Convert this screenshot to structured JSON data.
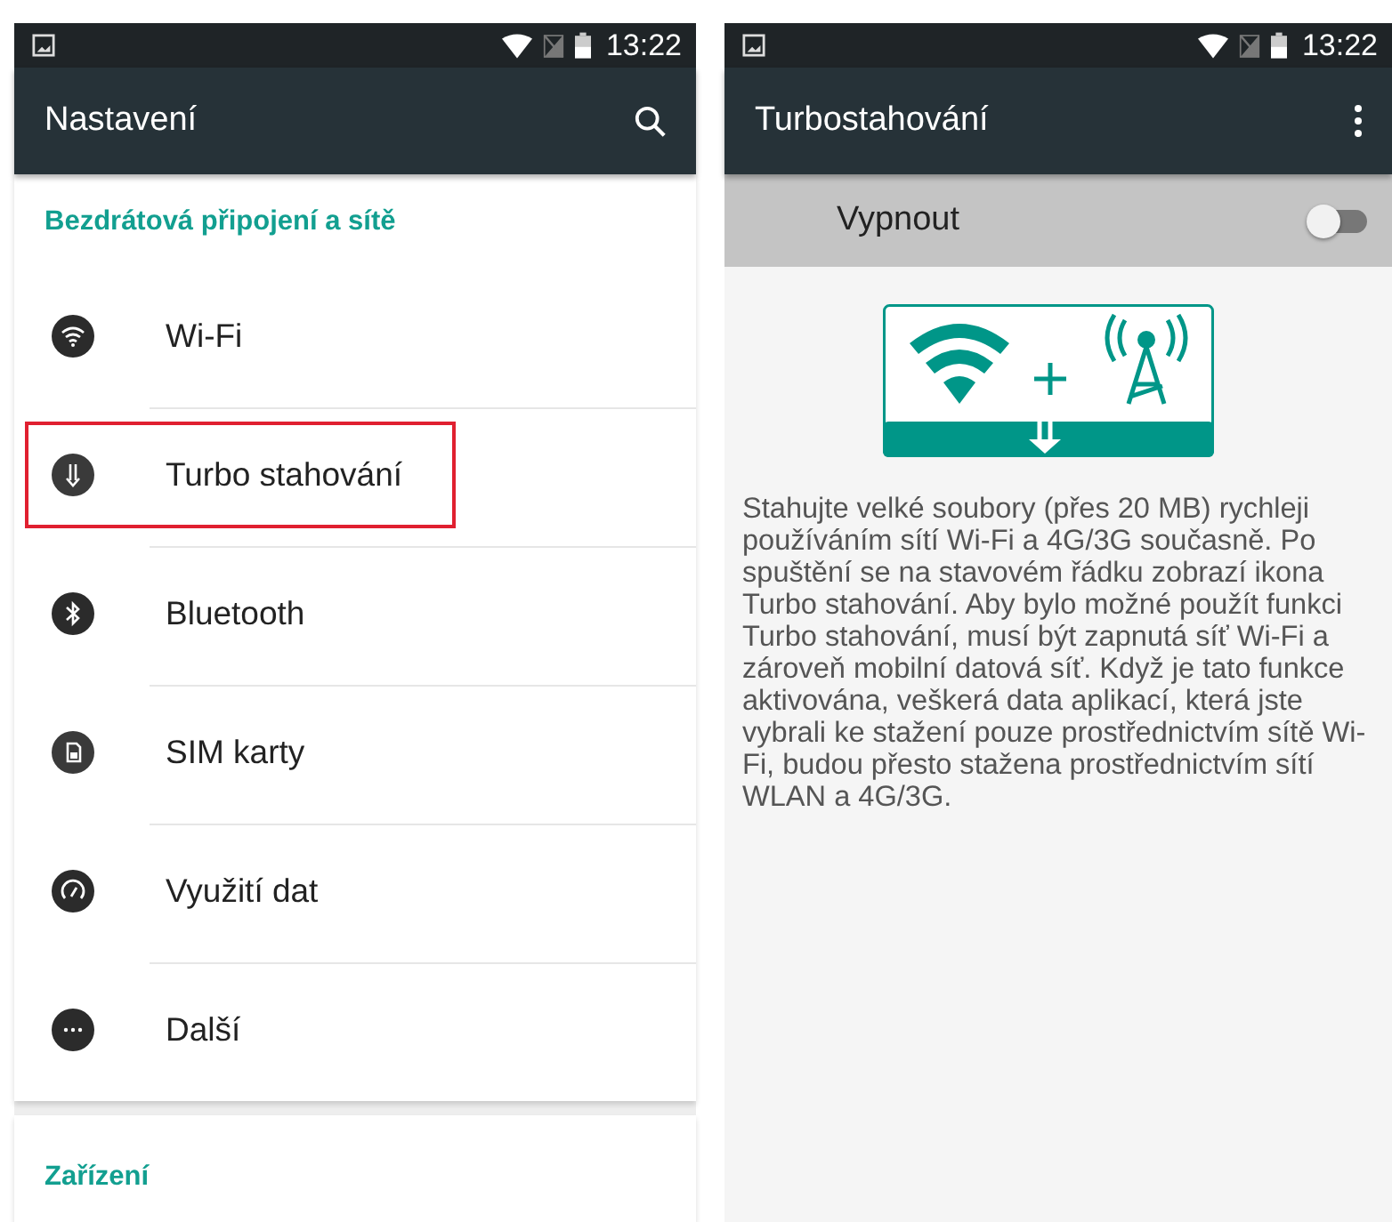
{
  "left_screen": {
    "status_bar": {
      "time": "13:22"
    },
    "app_bar": {
      "title": "Nastavení"
    },
    "sections": [
      {
        "header": "Bezdrátová připojení a sítě",
        "items": [
          {
            "label": "Wi-Fi",
            "kind": "wifi",
            "highlighted": false
          },
          {
            "label": "Turbo stahování",
            "kind": "download",
            "highlighted": true
          },
          {
            "label": "Bluetooth",
            "kind": "bluetooth",
            "highlighted": false
          },
          {
            "label": "SIM karty",
            "kind": "sim",
            "highlighted": false
          },
          {
            "label": "Využití dat",
            "kind": "gauge",
            "highlighted": false
          },
          {
            "label": "Další",
            "kind": "more",
            "highlighted": false
          }
        ]
      },
      {
        "header": "Zařízení"
      }
    ]
  },
  "right_screen": {
    "status_bar": {
      "time": "13:22"
    },
    "app_bar": {
      "title": "Turbostahování"
    },
    "switch_row": {
      "label": "Vypnout",
      "on": false
    },
    "description": "Stahujte velké soubory (přes 20 MB) rychleji používáním sítí Wi-Fi a 4G/3G současně. Po spuštění se na stavovém řádku zobrazí ikona Turbo stahování. Aby bylo možné použít funkci Turbo stahování, musí být zapnutá síť Wi-Fi a zároveň mobilní datová síť. Když je tato funkce aktivována, veškerá data aplikací, která jste vybrali ke stažení pouze prostřednictvím sítě Wi-Fi, budou přesto stažena prostřednictvím sítí WLAN a 4G/3G."
  }
}
